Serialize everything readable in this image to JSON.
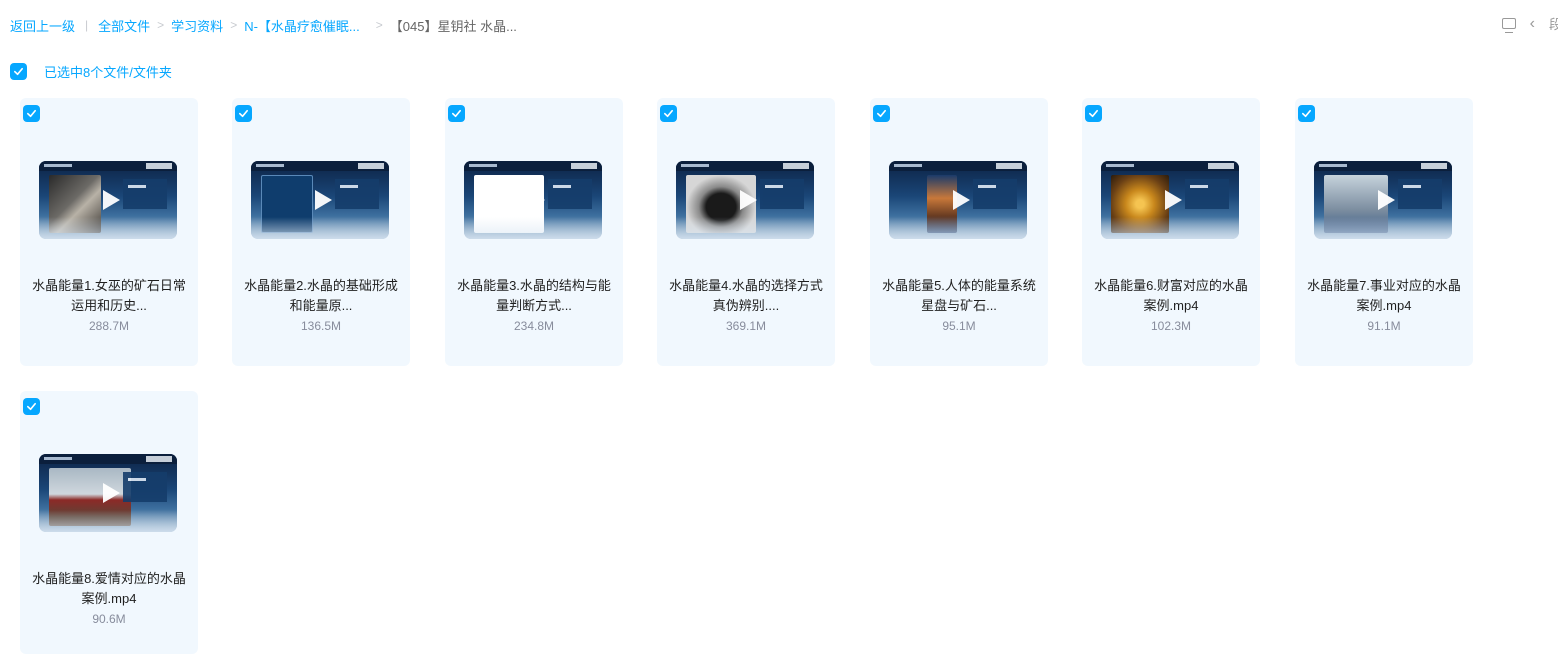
{
  "breadcrumb": {
    "back": "返回上一级",
    "items": [
      "全部文件",
      "学习资料",
      "N-【水晶疗愈催眠...",
      "【045】星钥社 水晶..."
    ]
  },
  "top_right": {
    "truncated_text": "段"
  },
  "selection": {
    "text": "已选中8个文件/文件夹"
  },
  "files": [
    {
      "name": "水晶能量1.女巫的矿石日常运用和历史...",
      "size": "288.7M"
    },
    {
      "name": "水晶能量2.水晶的基础形成和能量原...",
      "size": "136.5M"
    },
    {
      "name": "水晶能量3.水晶的结构与能量判断方式...",
      "size": "234.8M"
    },
    {
      "name": "水晶能量4.水晶的选择方式真伪辨别....",
      "size": "369.1M"
    },
    {
      "name": "水晶能量5.人体的能量系统星盘与矿石...",
      "size": "95.1M"
    },
    {
      "name": "水晶能量6.财富对应的水晶案例.mp4",
      "size": "102.3M"
    },
    {
      "name": "水晶能量7.事业对应的水晶案例.mp4",
      "size": "91.1M"
    },
    {
      "name": "水晶能量8.爱情对应的水晶案例.mp4",
      "size": "90.6M"
    }
  ],
  "colors": {
    "accent": "#06a7ff",
    "card_bg": "#f1f8fe",
    "size_text": "#878c9c"
  }
}
